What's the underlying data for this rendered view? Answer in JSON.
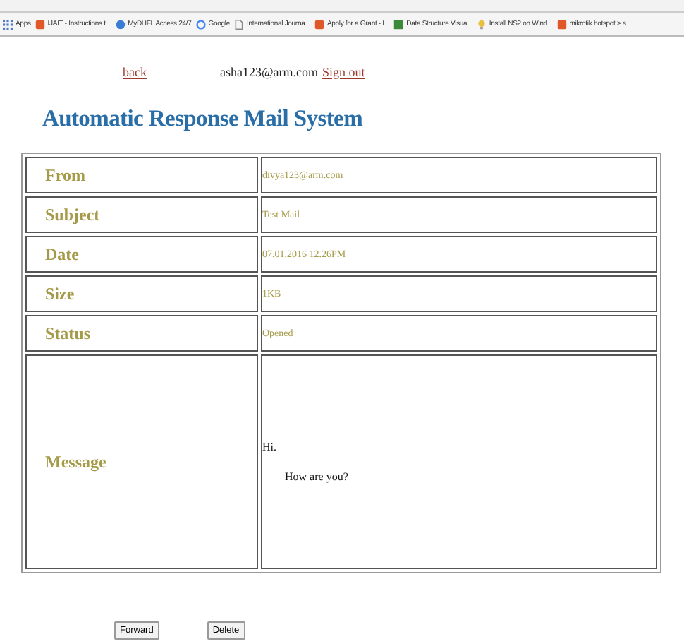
{
  "bookmarks": [
    {
      "label": "Apps",
      "kind": "apps"
    },
    {
      "label": "IJAIT - Instructions t...",
      "kind": "doc"
    },
    {
      "label": "MyDHFL Access 24/7",
      "kind": "globe"
    },
    {
      "label": "Google",
      "kind": "google"
    },
    {
      "label": "International Journa...",
      "kind": "page"
    },
    {
      "label": "Apply for a Grant - I...",
      "kind": "doc"
    },
    {
      "label": "Data Structure Visua...",
      "kind": "sheet"
    },
    {
      "label": "Install NS2 on Wind...",
      "kind": "bulb"
    },
    {
      "label": "mikrotik hotspot > s...",
      "kind": "doc"
    }
  ],
  "nav": {
    "back": "back",
    "user": "asha123@arm.com",
    "signout": "Sign out"
  },
  "title": "Automatic Response Mail System",
  "fields": [
    {
      "label": "From",
      "value": "divya123@arm.com",
      "kind": "plain"
    },
    {
      "label": "Subject",
      "value": "Test Mail",
      "kind": "plain"
    },
    {
      "label": "Date",
      "value": "07.01.2016 12.26PM",
      "kind": "plain"
    },
    {
      "label": "Size",
      "value": "1KB",
      "kind": "plain"
    },
    {
      "label": "Status",
      "value": "Opened",
      "kind": "plain"
    },
    {
      "label": "Message",
      "lines": [
        "Hi.",
        "How are you?"
      ],
      "kind": "message"
    }
  ],
  "buttons": [
    "Forward",
    "Delete"
  ]
}
